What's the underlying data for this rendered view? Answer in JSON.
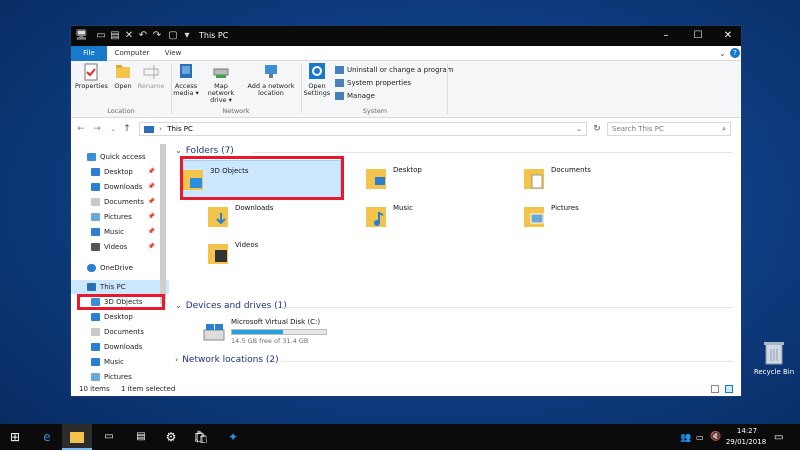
{
  "window": {
    "title": "This PC",
    "min": "–",
    "max": "☐",
    "close": "✕"
  },
  "tabs": [
    "File",
    "Computer",
    "View"
  ],
  "ribbon": {
    "location_label": "Location",
    "network_label": "Network",
    "system_label": "System",
    "properties": "Properties",
    "open": "Open",
    "rename": "Rename",
    "access_media_1": "Access",
    "access_media_2": "media ▾",
    "map_drive_1": "Map network",
    "map_drive_2": "drive ▾",
    "add_net_1": "Add a network",
    "add_net_2": "location",
    "open_settings_1": "Open",
    "open_settings_2": "Settings",
    "uninstall": "Uninstall or change a program",
    "sys_props": "System properties",
    "manage": "Manage"
  },
  "address": {
    "path": "This PC",
    "search_placeholder": "Search This PC"
  },
  "nav_pane": {
    "quick_access": "Quick access",
    "items": [
      "Desktop",
      "Downloads",
      "Documents",
      "Pictures",
      "Music",
      "Videos"
    ],
    "onedrive": "OneDrive",
    "this_pc": "This PC",
    "pc_items": [
      "3D Objects",
      "Desktop",
      "Documents",
      "Downloads",
      "Music",
      "Pictures"
    ]
  },
  "content": {
    "folders_header": "Folders (7)",
    "folders": [
      "3D Objects",
      "Desktop",
      "Documents",
      "Downloads",
      "Music",
      "Pictures",
      "Videos"
    ],
    "devices_header": "Devices and drives (1)",
    "drive_name": "Microsoft Virtual Disk (C:)",
    "drive_free": "14.5 GB free of 31.4 GB",
    "drive_used_fraction": 0.54,
    "network_header": "Network locations (2)"
  },
  "status": {
    "items": "10 items",
    "selected": "1 item selected"
  },
  "taskbar": {
    "time": "14:27",
    "date": "29/01/2018"
  },
  "desktop": {
    "recycle_bin": "Recycle Bin"
  },
  "colors": {
    "accent": "#1979ca",
    "highlight_box": "#e8192c",
    "folder": "#f3c44b",
    "selection": "#cce8ff"
  }
}
